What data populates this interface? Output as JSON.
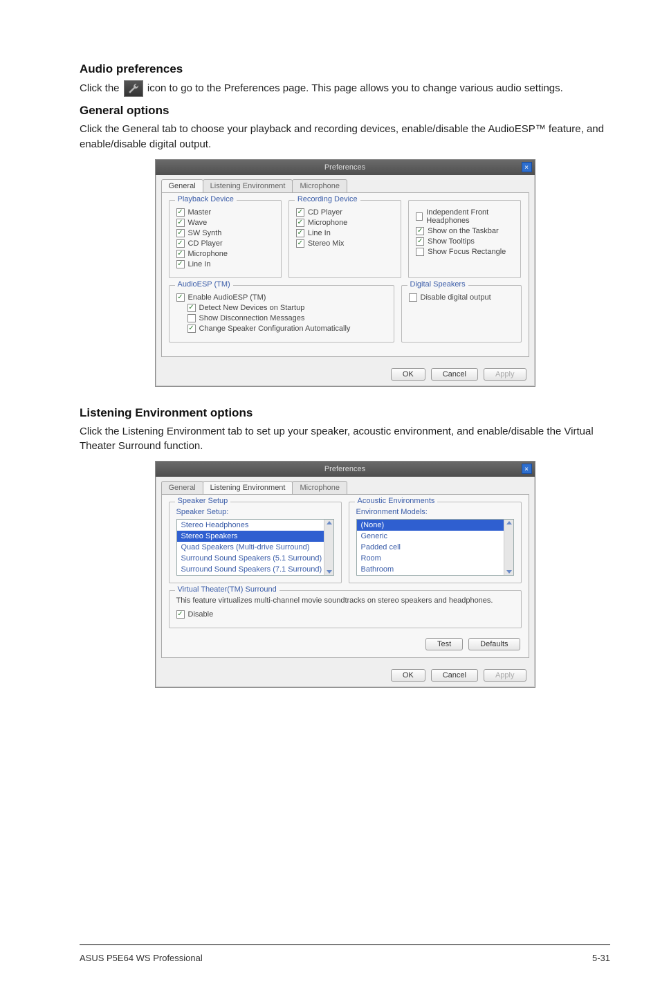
{
  "sections": {
    "audio": {
      "heading": "Audio preferences",
      "para_pre": "Click the ",
      "para_post": " icon to go to the Preferences page. This page allows you to change various audio settings."
    },
    "general": {
      "heading": "General options",
      "para": "Click the General tab to choose your playback and recording devices, enable/disable the AudioESP™ feature, and enable/disable digital output."
    },
    "listening": {
      "heading": "Listening Environment options",
      "para": "Click the Listening Environment tab to set up your speaker, acoustic environment, and enable/disable the Virtual Theater Surround function."
    }
  },
  "dialog1": {
    "title": "Preferences",
    "tabs": [
      "General",
      "Listening Environment",
      "Microphone"
    ],
    "active_tab": 0,
    "groups": {
      "playback": {
        "legend": "Playback Device",
        "items": [
          {
            "label": "Master",
            "checked": true
          },
          {
            "label": "Wave",
            "checked": true
          },
          {
            "label": "SW Synth",
            "checked": true
          },
          {
            "label": "CD Player",
            "checked": true
          },
          {
            "label": "Microphone",
            "checked": true
          },
          {
            "label": "Line In",
            "checked": true
          }
        ]
      },
      "recording": {
        "legend": "Recording Device",
        "items": [
          {
            "label": "CD Player",
            "checked": true
          },
          {
            "label": "Microphone",
            "checked": true
          },
          {
            "label": "Line In",
            "checked": true
          },
          {
            "label": "Stereo Mix",
            "checked": true
          }
        ]
      },
      "right": {
        "legend": "",
        "items": [
          {
            "label": "Independent Front Headphones",
            "checked": false
          },
          {
            "label": "Show on the Taskbar",
            "checked": true
          },
          {
            "label": "Show Tooltips",
            "checked": true
          },
          {
            "label": "Show Focus Rectangle",
            "checked": false
          }
        ]
      },
      "audioesp": {
        "legend": "AudioESP (TM)",
        "items": [
          {
            "label": "Enable AudioESP (TM)",
            "checked": true
          },
          {
            "label": "Detect New Devices on Startup",
            "checked": true
          },
          {
            "label": "Show Disconnection Messages",
            "checked": false
          },
          {
            "label": "Change Speaker Configuration Automatically",
            "checked": true
          }
        ]
      },
      "digital": {
        "legend": "Digital Speakers",
        "items": [
          {
            "label": "Disable digital output",
            "checked": false
          }
        ]
      }
    },
    "buttons": {
      "ok": "OK",
      "cancel": "Cancel",
      "apply": "Apply"
    }
  },
  "dialog2": {
    "title": "Preferences",
    "tabs": [
      "General",
      "Listening Environment",
      "Microphone"
    ],
    "active_tab": 1,
    "speaker_setup": {
      "legend": "Speaker Setup",
      "sublabel": "Speaker Setup:",
      "options": [
        "Stereo Headphones",
        "Stereo Speakers",
        "Quad Speakers (Multi-drive Surround)",
        "Surround Sound Speakers (5.1 Surround)",
        "Surround Sound Speakers (7.1 Surround)"
      ],
      "selected_index": 1
    },
    "acoustic": {
      "legend": "Acoustic Environments",
      "sublabel": "Environment Models:",
      "options": [
        "(None)",
        "Generic",
        "Padded cell",
        "Room",
        "Bathroom"
      ],
      "selected_index": 0
    },
    "vts": {
      "legend": "Virtual Theater(TM) Surround",
      "desc": "This feature virtualizes multi-channel movie soundtracks on stereo speakers and headphones.",
      "disable": {
        "label": "Disable",
        "checked": true
      }
    },
    "buttons": {
      "test": "Test",
      "defaults": "Defaults",
      "ok": "OK",
      "cancel": "Cancel",
      "apply": "Apply"
    }
  },
  "footer": {
    "left": "ASUS P5E64 WS Professional",
    "right": "5-31"
  }
}
